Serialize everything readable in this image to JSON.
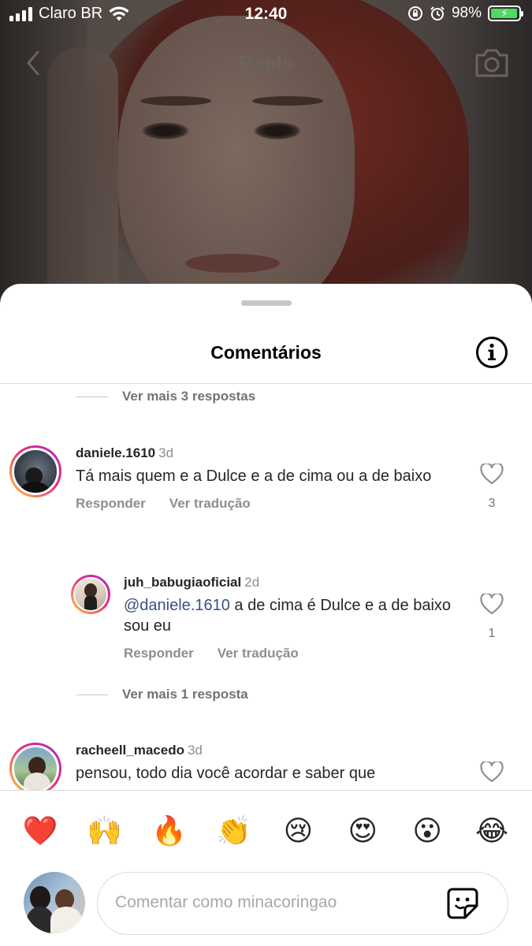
{
  "status_bar": {
    "carrier": "Claro BR",
    "time": "12:40",
    "battery": "98%",
    "battery_level": 0.98
  },
  "video": {
    "title": "Reels"
  },
  "sheet": {
    "title": "Comentários"
  },
  "comments": {
    "top_more_replies": "Ver mais 3 respostas",
    "items": [
      {
        "username": "daniele.1610",
        "time": "3d",
        "text": "Tá mais quem e a Dulce e a de cima ou a de baixo",
        "reply_label": "Responder",
        "translate_label": "Ver tradução",
        "likes": "3"
      },
      {
        "username": "juh_babugiaoficial",
        "time": "2d",
        "mention": "@daniele.1610",
        "text": " a de cima é  Dulce e a de baixo sou eu",
        "reply_label": "Responder",
        "translate_label": "Ver tradução",
        "likes": "1"
      },
      {
        "username": "racheell_macedo",
        "time": "3d",
        "text": "pensou, todo dia você acordar e saber que"
      }
    ],
    "more_replies_2": "Ver mais 1 resposta"
  },
  "reactions": [
    "❤️",
    "🙌",
    "🔥",
    "👏",
    "😢",
    "😍",
    "😮",
    "😂"
  ],
  "composer": {
    "placeholder": "Comentar como minacoringao"
  },
  "colors": {
    "accent_ring_start": "#f9ce34",
    "accent_ring_mid": "#ee2a7b",
    "accent_ring_end": "#a72ad4",
    "mention": "#385185",
    "battery_green": "#4cd964"
  }
}
